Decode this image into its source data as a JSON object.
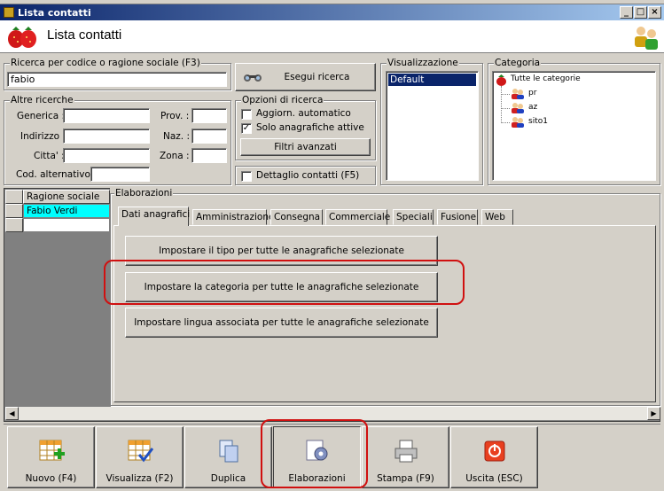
{
  "window": {
    "title": "Lista contatti"
  },
  "header": {
    "title": "Lista contatti"
  },
  "search": {
    "group_label": "Ricerca per codice o ragione sociale (F3)",
    "value": "fabio",
    "button": "Esegui ricerca"
  },
  "other_search": {
    "group_label": "Altre ricerche",
    "generica": "Generica :",
    "indirizzo": "Indirizzo :",
    "citta": "Citta' :",
    "cod_alt": "Cod. alternativo :",
    "prov": "Prov. :",
    "naz": "Naz. :",
    "zona": "Zona :"
  },
  "options": {
    "group_label": "Opzioni di ricerca",
    "auto_update": "Aggiorn. automatico",
    "only_active": "Solo anagrafiche attive",
    "advanced_filters": "Filtri avanzati",
    "contact_detail": "Dettaglio contatti (F5)"
  },
  "view": {
    "group_label": "Visualizzazione",
    "items": [
      "Default"
    ]
  },
  "category": {
    "group_label": "Categoria",
    "root": "Tutte le categorie",
    "children": [
      "pr",
      "az",
      "sito1"
    ]
  },
  "grid": {
    "column": "Ragione sociale",
    "rows": [
      "Fabio Verdi"
    ]
  },
  "processing": {
    "group_label": "Elaborazioni",
    "tabs": [
      "Dati anagrafici",
      "Amministrazione",
      "Consegna",
      "Commerciale",
      "Speciali",
      "Fusione",
      "Web"
    ],
    "actions": [
      "Impostare il tipo per tutte le anagrafiche selezionate",
      "Impostare la categoria per tutte le anagrafiche selezionate",
      "Impostare lingua associata per tutte le anagrafiche selezionate"
    ]
  },
  "toolbar": {
    "new": "Nuovo (F4)",
    "view": "Visualizza (F2)",
    "duplicate": "Duplica",
    "processing": "Elaborazioni",
    "print": "Stampa (F9)",
    "exit": "Uscita (ESC)"
  },
  "colors": {
    "title_start": "#0a246a",
    "title_end": "#a6caf0",
    "selection": "#0a246a",
    "grid_row": "#00ffff",
    "highlight": "#d01010"
  }
}
